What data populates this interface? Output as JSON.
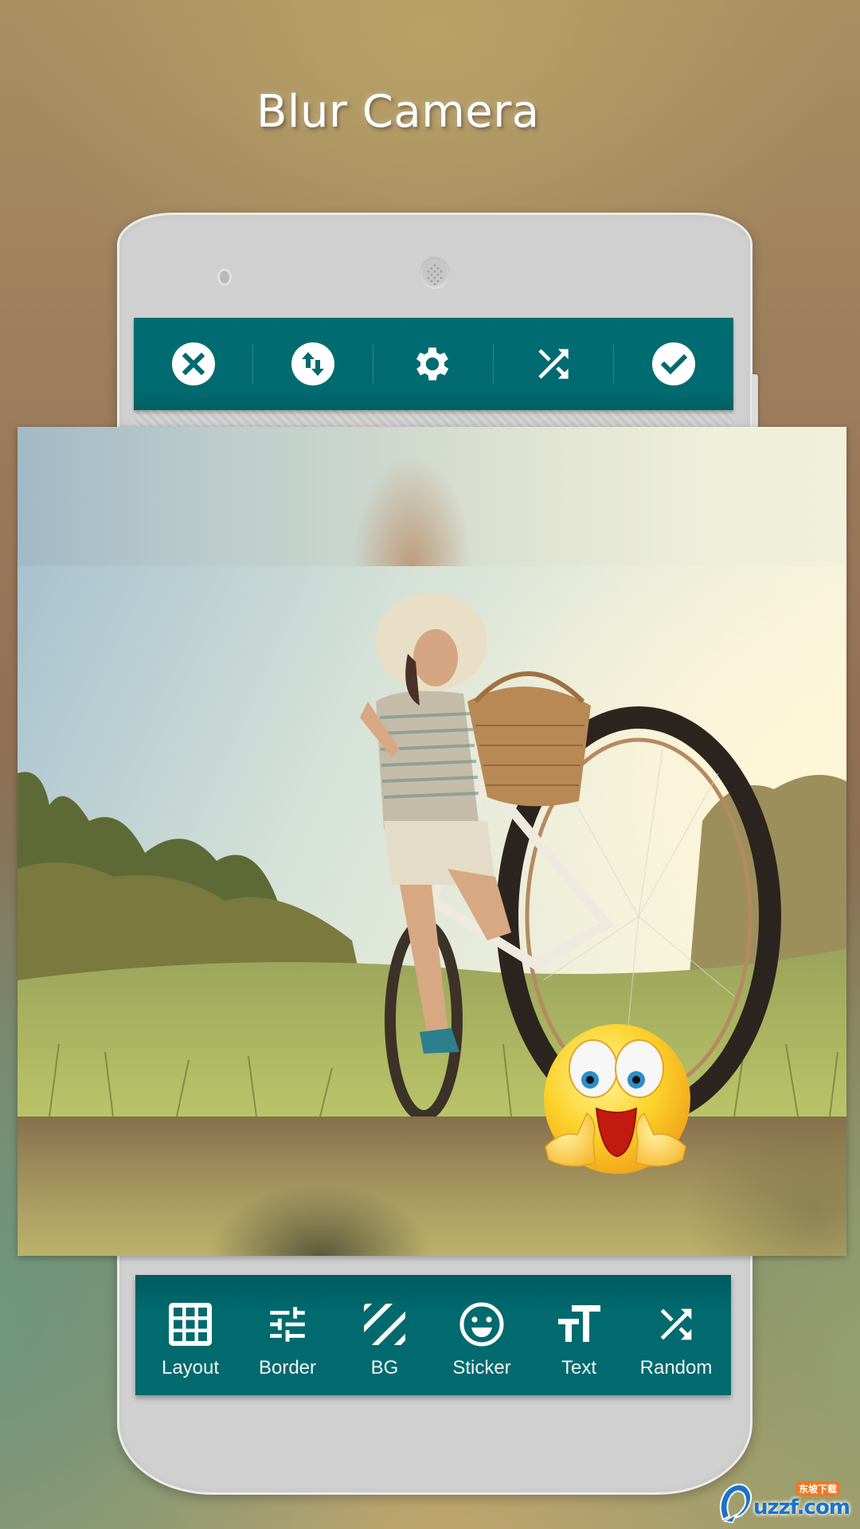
{
  "promo": {
    "title": "Blur Camera"
  },
  "top_toolbar": {
    "items": [
      {
        "name": "close",
        "icon": "close-circle-icon"
      },
      {
        "name": "swap",
        "icon": "swap-vertical-icon"
      },
      {
        "name": "settings",
        "icon": "gear-icon"
      },
      {
        "name": "shuffle",
        "icon": "shuffle-icon"
      },
      {
        "name": "confirm",
        "icon": "check-circle-icon"
      }
    ]
  },
  "canvas": {
    "photo_subject": "woman riding bicycle in sunny field",
    "sticker": "surprised-smiley-emoji"
  },
  "bottom_toolbar": {
    "items": [
      {
        "label": "Layout",
        "icon": "grid-icon"
      },
      {
        "label": "Border",
        "icon": "sliders-icon"
      },
      {
        "label": "BG",
        "icon": "stripes-icon"
      },
      {
        "label": "Sticker",
        "icon": "smiley-icon"
      },
      {
        "label": "Text",
        "icon": "text-size-icon"
      },
      {
        "label": "Random",
        "icon": "shuffle-icon"
      }
    ]
  },
  "watermark": {
    "brand": "uzzf.com",
    "brand_cn": "东坡下载"
  },
  "colors": {
    "toolbar_teal": "#006a6f",
    "icon_white": "#ffffff",
    "phone_body": "#d0d0d0"
  }
}
